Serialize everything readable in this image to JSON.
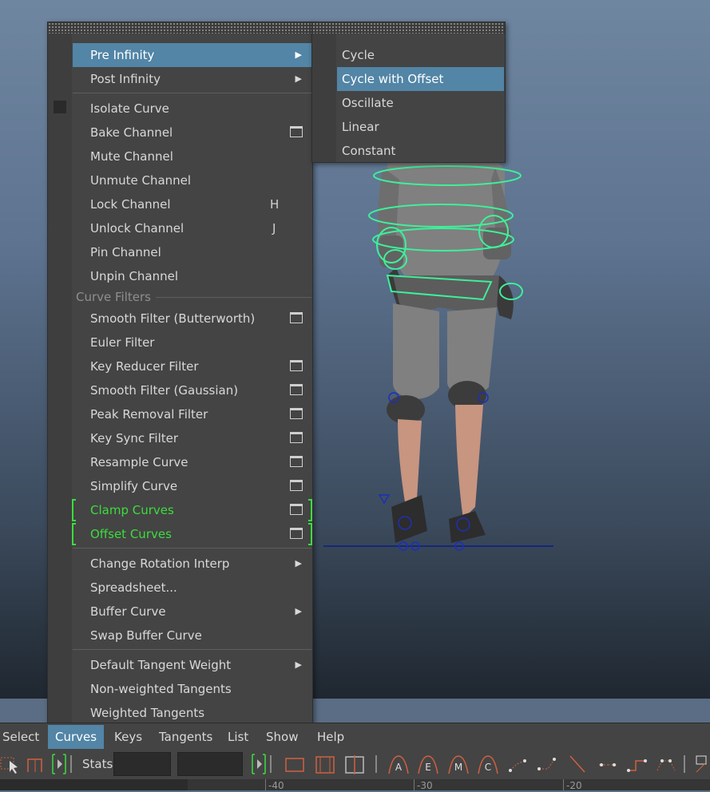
{
  "menu": {
    "items": [
      {
        "label": "Pre Infinity",
        "submenu": true,
        "highlighted": true
      },
      {
        "label": "Post Infinity",
        "submenu": true
      },
      {
        "label": "Isolate Curve"
      },
      {
        "label": "Bake Channel",
        "option_box": true
      },
      {
        "label": "Mute Channel"
      },
      {
        "label": "Unmute Channel"
      },
      {
        "label": "Lock Channel",
        "shortcut": "H"
      },
      {
        "label": "Unlock Channel",
        "shortcut": "J"
      },
      {
        "label": "Pin Channel"
      },
      {
        "label": "Unpin Channel"
      },
      {
        "label": "Smooth Filter (Butterworth)",
        "option_box": true
      },
      {
        "label": "Euler Filter"
      },
      {
        "label": "Key Reducer Filter",
        "option_box": true
      },
      {
        "label": "Smooth Filter (Gaussian)",
        "option_box": true
      },
      {
        "label": "Peak Removal Filter",
        "option_box": true
      },
      {
        "label": "Key Sync Filter",
        "option_box": true
      },
      {
        "label": "Resample Curve",
        "option_box": true
      },
      {
        "label": "Simplify Curve",
        "option_box": true
      },
      {
        "label": "Clamp Curves",
        "option_box": true,
        "green": true
      },
      {
        "label": "Offset Curves",
        "option_box": true,
        "green": true
      },
      {
        "label": "Change Rotation Interp",
        "submenu": true
      },
      {
        "label": "Spreadsheet..."
      },
      {
        "label": "Buffer Curve",
        "submenu": true
      },
      {
        "label": "Swap Buffer Curve"
      },
      {
        "label": "Default Tangent Weight",
        "submenu": true
      },
      {
        "label": "Non-weighted Tangents"
      },
      {
        "label": "Weighted Tangents"
      }
    ],
    "section_curve_filters": "Curve Filters"
  },
  "submenu": {
    "items": [
      {
        "label": "Cycle"
      },
      {
        "label": "Cycle with Offset",
        "highlighted": true
      },
      {
        "label": "Oscillate"
      },
      {
        "label": "Linear"
      },
      {
        "label": "Constant"
      }
    ]
  },
  "menubar": {
    "items": [
      {
        "label": "Select"
      },
      {
        "label": "Curves",
        "active": true
      },
      {
        "label": "Keys"
      },
      {
        "label": "Tangents"
      },
      {
        "label": "List"
      },
      {
        "label": "Show"
      },
      {
        "label": "Help"
      }
    ]
  },
  "toolbar": {
    "stats_label": "Stats",
    "icon_letters": [
      "A",
      "E",
      "M",
      "C"
    ]
  },
  "ruler": {
    "ticks": [
      "-40",
      "-30",
      "-20"
    ]
  },
  "colors": {
    "highlight": "#5285a6",
    "green": "#3ddc3d",
    "menu_bg": "#444444"
  }
}
